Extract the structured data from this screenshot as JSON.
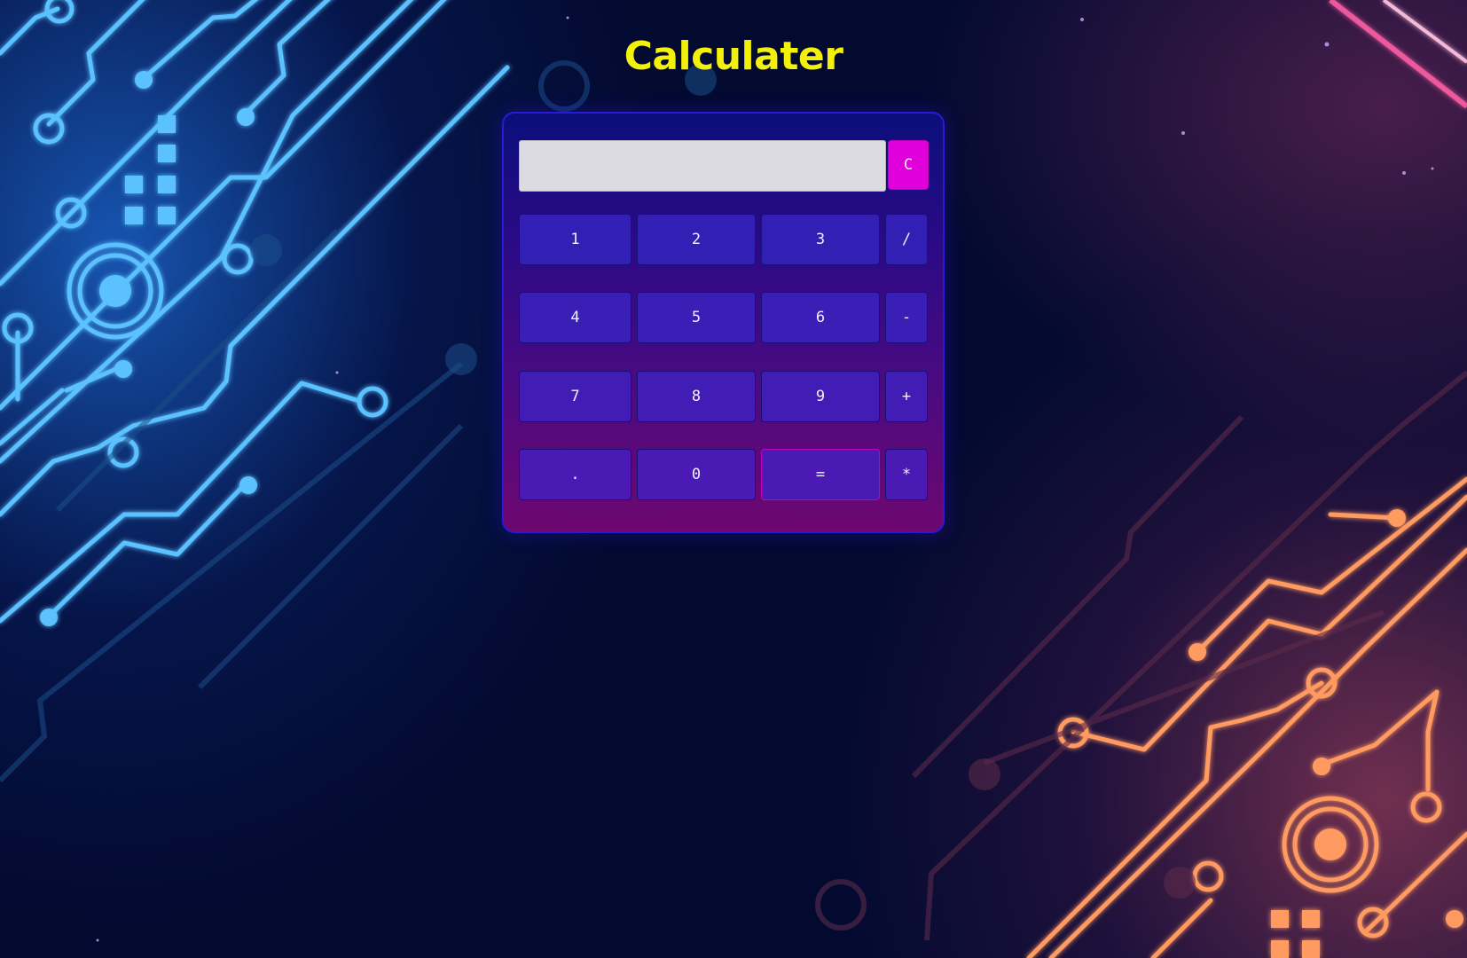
{
  "app": {
    "title": "Calculater",
    "title_color": "#f3f00a"
  },
  "display": {
    "value": "",
    "clear_label": "C"
  },
  "keypad": {
    "rows": [
      [
        "1",
        "2",
        "3",
        "/"
      ],
      [
        "4",
        "5",
        "6",
        "-"
      ],
      [
        "7",
        "8",
        "9",
        "+"
      ],
      [
        ".",
        "0",
        "=",
        "*"
      ]
    ]
  },
  "colors": {
    "accent": "#e000da",
    "button": "#3220b4",
    "display_bg": "#dddbe2"
  }
}
